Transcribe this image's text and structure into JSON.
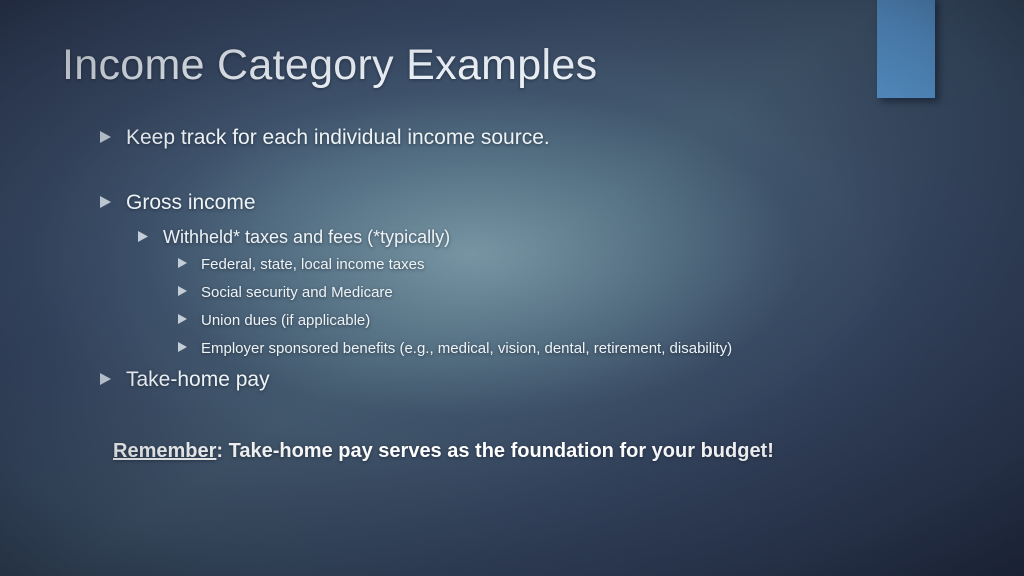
{
  "slide": {
    "title": "Income Category Examples",
    "accent_color": "#5b9bd5",
    "background_colors": {
      "dark_navy": "#2d3851",
      "mid_slate": "#41566b",
      "center_glow": "#5b7d8c"
    },
    "text_color": "#eef3f6",
    "bullet_marker": "triangle-right-icon",
    "bullets": [
      {
        "level": 1,
        "text": "Keep track for each individual income source."
      },
      {
        "level": 1,
        "text": "Gross income"
      },
      {
        "level": 2,
        "text": "Withheld* taxes and fees (*typically)"
      },
      {
        "level": 3,
        "text": "Federal, state, local income taxes"
      },
      {
        "level": 3,
        "text": "Social security and Medicare"
      },
      {
        "level": 3,
        "text": "Union dues (if applicable)"
      },
      {
        "level": 3,
        "text": "Employer sponsored benefits (e.g., medical, vision, dental, retirement, disability)"
      },
      {
        "level": 1,
        "text": "Take-home pay"
      }
    ],
    "closing_line": {
      "underlined_word": "Remember",
      "rest": ": Take-home pay serves as the foundation for your budget!"
    }
  }
}
